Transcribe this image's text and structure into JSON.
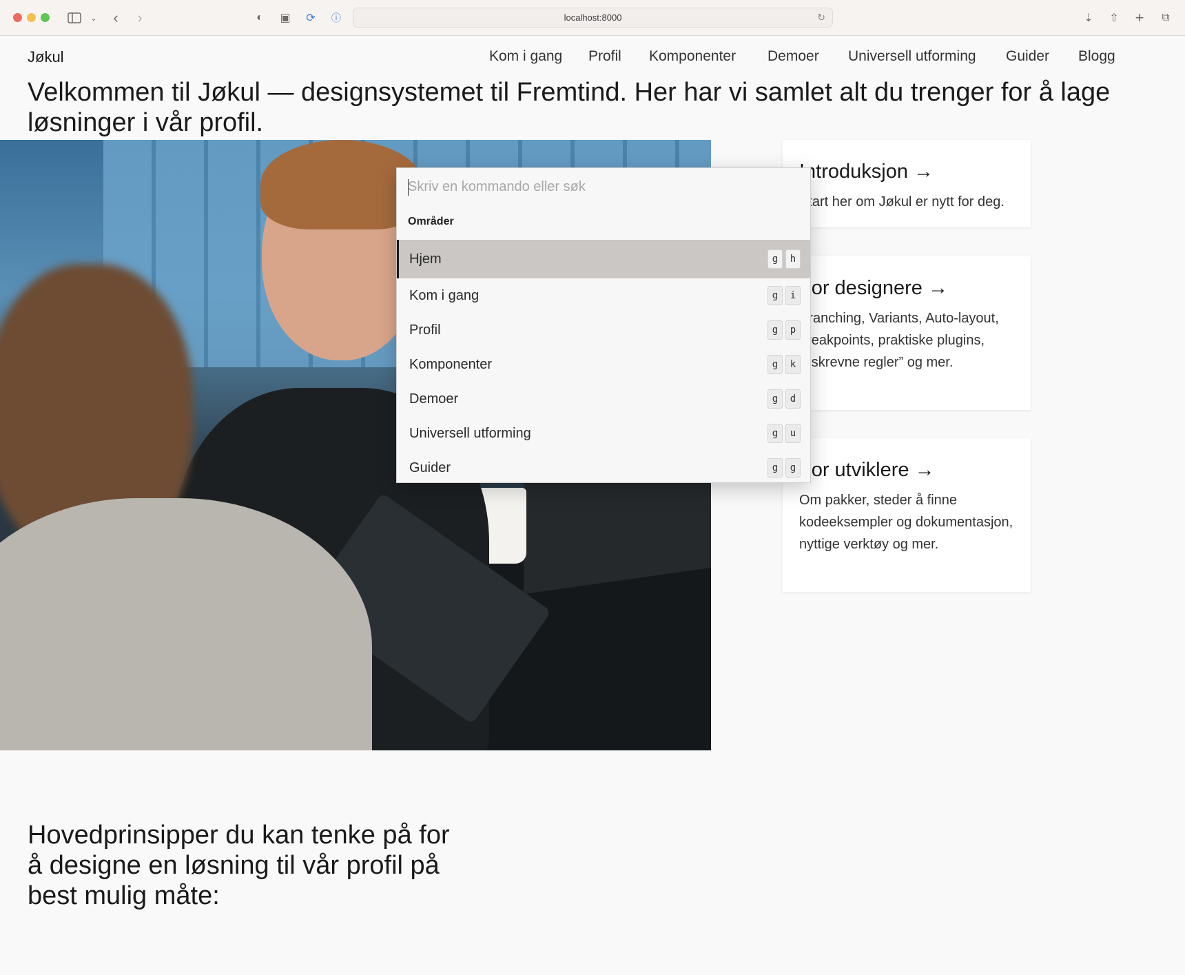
{
  "browser": {
    "url": "localhost:8000",
    "icons": [
      "sidebar-icon",
      "chevron-down-icon",
      "back-icon",
      "forward-icon",
      "privacy-icon",
      "reader-icon",
      "extension-icon",
      "password-icon",
      "reload-icon",
      "download-icon",
      "share-icon",
      "new-tab-icon",
      "tabs-overview-icon"
    ]
  },
  "site": {
    "logo": "Jøkul",
    "nav": [
      "Kom i gang",
      "Profil",
      "Komponenter",
      "Demoer",
      "Universell utforming",
      "Guider",
      "Blogg"
    ],
    "hero_title": "Velkommen til Jøkul — designsystemet til Fremtind. Her har vi samlet alt du trenger for å lage løsninger i vår profil."
  },
  "cards": [
    {
      "title": "Introduksjon →",
      "text": "Start her om Jøkul er nytt for deg."
    },
    {
      "title": "For designere →",
      "text": "Branching, Variants, Auto-layout, breakpoints, praktiske plugins, “uskrevne regler” og mer."
    },
    {
      "title": "For utviklere →",
      "text": "Om pakker, steder å finne kodeeksempler og dokumentasjon, nyttige verktøy og mer."
    }
  ],
  "principles_title": "Hovedprinsipper du kan tenke på for å designe en løsning til vår profil på best mulig måte:",
  "palette": {
    "placeholder": "Skriv en kommando eller søk",
    "input_value": "",
    "section": "Områder",
    "items": [
      {
        "label": "Hjem",
        "keys": [
          "g",
          "h"
        ],
        "active": true
      },
      {
        "label": "Kom i gang",
        "keys": [
          "g",
          "i"
        ],
        "active": false
      },
      {
        "label": "Profil",
        "keys": [
          "g",
          "p"
        ],
        "active": false
      },
      {
        "label": "Komponenter",
        "keys": [
          "g",
          "k"
        ],
        "active": false
      },
      {
        "label": "Demoer",
        "keys": [
          "g",
          "d"
        ],
        "active": false
      },
      {
        "label": "Universell utforming",
        "keys": [
          "g",
          "u"
        ],
        "active": false
      },
      {
        "label": "Guider",
        "keys": [
          "g",
          "g"
        ],
        "active": false
      }
    ]
  },
  "colors": {
    "page_background": "#f9f9f9",
    "active_item_background": "#cbc7c4",
    "traffic_red": "#ed6a5e",
    "traffic_yellow": "#f5bf4f",
    "traffic_green": "#61c554"
  }
}
